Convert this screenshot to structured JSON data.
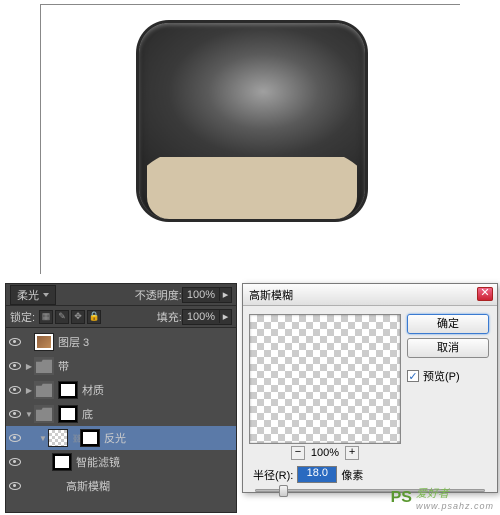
{
  "layers_panel": {
    "blend_mode": "柔光",
    "opacity_label": "不透明度:",
    "opacity_value": "100%",
    "lock_label": "锁定:",
    "fill_label": "填充:",
    "fill_value": "100%",
    "items": [
      {
        "name": "图层 3",
        "type": "image"
      },
      {
        "name": "带",
        "type": "folder"
      },
      {
        "name": "材质",
        "type": "folder_mask"
      },
      {
        "name": "底",
        "type": "folder_mask"
      },
      {
        "name": "反光",
        "type": "smart",
        "selected": true
      },
      {
        "name": "智能滤镜",
        "type": "filter_header"
      },
      {
        "name": "高斯模糊",
        "type": "filter"
      }
    ]
  },
  "dialog": {
    "title": "高斯模糊",
    "ok": "确定",
    "cancel": "取消",
    "preview_label": "预览(P)",
    "preview_checked": "✓",
    "zoom_value": "100%",
    "radius_label": "半径(R):",
    "radius_value": "18.0",
    "radius_unit": "像素",
    "close_x": "✕"
  },
  "watermark": {
    "ps": "PS",
    "text": "爱好者",
    "url": "www.psahz.com"
  }
}
